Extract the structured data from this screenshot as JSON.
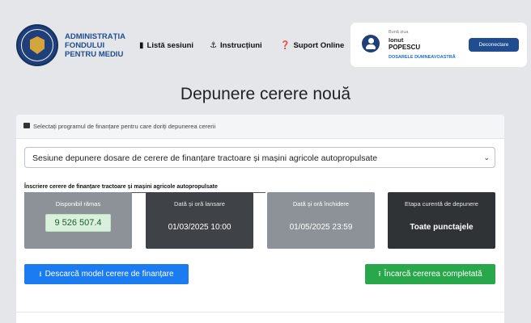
{
  "header": {
    "org_name": "ADMINISTRAȚIA FONDULUI PENTRU MEDIU",
    "nav": {
      "sessions": "Listă sesiuni",
      "instructions": "Instrucțiuni",
      "support": "Suport Online"
    },
    "user": {
      "greeting": "Bună ziua",
      "first_name": "Ionut",
      "last_name": "POPESCU",
      "files_link": "DOSARELE DUMNEAVOASTRĂ",
      "logout": "Deconectare"
    }
  },
  "page_title": "Depunere cerere nouă",
  "form": {
    "prompt": "Selectați programul de finanțare pentru care doriți depunerea cererii",
    "selected_program": "Sesiune depunere dosare de cerere de finanțare tractoare și mașini agricole autopropulsate",
    "section_label": "Înscriere cerere de finanțare tractoare și mașini agricole autopropulsate",
    "tiles": {
      "available_label": "Disponibil rămas",
      "available_value": "9 526 507.4",
      "launch_label": "Dată și oră lansare",
      "launch_value": "01/03/2025 10:00",
      "close_label": "Dată și oră închidere",
      "close_value": "01/05/2025 23:59",
      "stage_label": "Etapa curentă de depunere",
      "stage_value": "Toate punctajele"
    },
    "download_button": "Descarcă model cerere de finanțare",
    "upload_button": "Încarcă cererea completată"
  },
  "icons": {
    "sessions": "bookmark-icon",
    "instructions": "instructions-icon",
    "support": "help-icon",
    "download": "download-icon",
    "upload": "upload-icon"
  },
  "colors": {
    "brand_blue": "#1f4d8f",
    "primary_button": "#1a7cf0",
    "success_button": "#28a84a"
  }
}
